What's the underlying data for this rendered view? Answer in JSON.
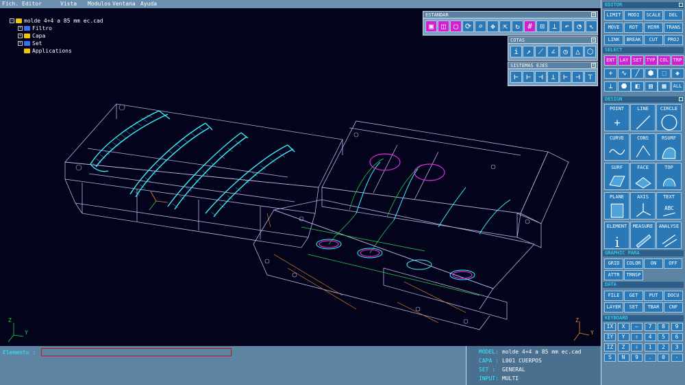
{
  "menu": [
    "Fich.",
    "Editor",
    "Vista",
    "Modulos",
    "Ventana",
    "Ayuda"
  ],
  "tree": {
    "root": "molde 4+4 a 85 mm ec.cad",
    "items": [
      "Filtro",
      "Capa",
      "Set",
      "Applications"
    ]
  },
  "palettes": {
    "estandar": {
      "title": "ESTANDAR"
    },
    "cotas": {
      "title": "COTAS"
    },
    "sistemas": {
      "title": "SISTEMAS EJES"
    }
  },
  "command": {
    "label": "Elemento :",
    "value": ""
  },
  "info": {
    "model_k": "MODEL:",
    "model_v": "molde 4+4 a 85 mm ec.cad",
    "capa_k": "CAPA :",
    "capa_v": "L001 CUERPOS",
    "set_k": "SET  :",
    "set_v": "GENERAL",
    "input_k": "INPUT:",
    "input_v": "MULTI"
  },
  "sidebar": {
    "editor_title": "EDITOR",
    "editor": [
      "LIMIT",
      "MODI",
      "SCALE",
      "DEL",
      "MOVE",
      "ROT",
      "MIRR",
      "TRANS",
      "LINK",
      "BREAK",
      "CUT",
      "PROJ"
    ],
    "select_title": "SELECT",
    "select": [
      "ENT",
      "LAY",
      "SET",
      "TYP",
      "COL",
      "TRP"
    ],
    "select_all": "ALL",
    "design_title": "DESIGN",
    "design": [
      "POINT",
      "LINE",
      "CIRCLE",
      "CURVE",
      "CONS",
      "RSURF",
      "SURF",
      "FACE",
      "TOP",
      "PLANE",
      "AXIS",
      "TEXT",
      "ELEMENT",
      "MEASURE",
      "ANALYSE"
    ],
    "graphic_title": "GRAPHIC PARA",
    "graphic": [
      "GRID",
      "COLOR",
      "ON",
      "OFF",
      "ATTR",
      "TRNSP"
    ],
    "data_title": "DATA",
    "data": [
      "FILE",
      "GET",
      "PUT",
      "DOCU",
      "LAYER",
      "SET",
      "TBAR",
      "CNF"
    ],
    "keyboard_title": "KEYBOARD",
    "keys": [
      "IX",
      "X",
      "⇦",
      "7",
      "8",
      "9",
      "IY",
      "Y",
      "⇧",
      "4",
      "5",
      "6",
      "IZ",
      "Z",
      "⇩",
      "1",
      "2",
      "3",
      "S",
      "N",
      "9",
      ".",
      "0",
      "-"
    ]
  },
  "axis_labels": {
    "x": "X",
    "y": "Y",
    "z": "Z"
  },
  "colors": {
    "viewport": "#03041c",
    "cyan": "#3ef2ff",
    "wire": "#b9b6e6",
    "magenta": "#e02be0",
    "green": "#28d84a",
    "orange": "#f0901e"
  }
}
